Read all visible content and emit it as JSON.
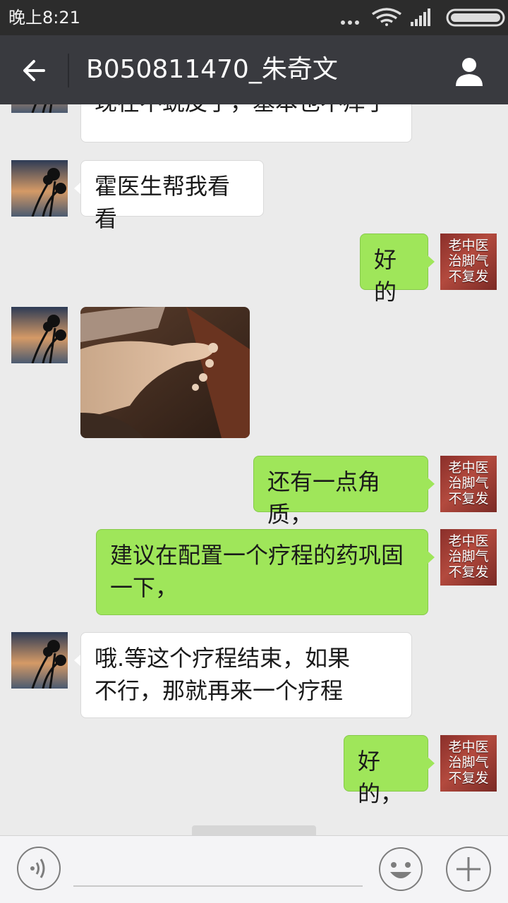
{
  "status_bar": {
    "time": "晚上8:21"
  },
  "header": {
    "title": "B050811470_朱奇文",
    "back_icon": "arrow-left-icon",
    "profile_icon": "person-icon"
  },
  "ad_avatar": {
    "lines": [
      "老中医",
      "治脚气",
      "不复发"
    ]
  },
  "messages": [
    {
      "side": "in",
      "text": "现在不蜕皮了，基本也不痒了"
    },
    {
      "side": "in",
      "text": "霍医生帮我看看"
    },
    {
      "side": "out",
      "text": "好的"
    },
    {
      "side": "in",
      "type": "image",
      "text": ""
    },
    {
      "side": "out",
      "text": "还有一点角质，"
    },
    {
      "side": "out",
      "text": "建议在配置一个疗程的药巩固一下，"
    },
    {
      "side": "in",
      "text": "哦.等这个疗程结束，如果不行，那就再来一个疗程"
    },
    {
      "side": "out",
      "text": "好的，"
    }
  ],
  "input_bar": {
    "voice_icon": "voice-icon",
    "emoji_icon": "smiley-icon",
    "plus_icon": "plus-icon"
  },
  "colors": {
    "status_bar_bg": "#2c2c2c",
    "title_bar_bg": "#393a3f",
    "chat_bg": "#ebebeb",
    "incoming_bubble": "#ffffff",
    "outgoing_bubble": "#9fe65a"
  }
}
